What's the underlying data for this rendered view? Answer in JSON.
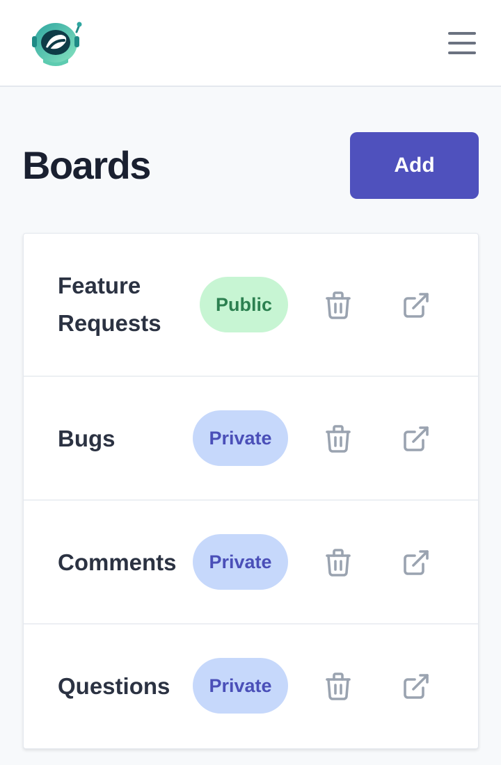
{
  "header": {
    "logo_icon": "astronaut-helmet-logo",
    "menu_icon": "hamburger-menu-icon"
  },
  "page": {
    "title": "Boards",
    "add_label": "Add"
  },
  "colors": {
    "primary": "#4f51bd",
    "public_bg": "#c7f5d3",
    "public_text": "#2c8050",
    "private_bg": "#c6d8fb",
    "private_text": "#4a4fb8",
    "icon_gray": "#9aa3b0"
  },
  "boards": [
    {
      "name": "Feature Requests",
      "visibility": "Public"
    },
    {
      "name": "Bugs",
      "visibility": "Private"
    },
    {
      "name": "Comments",
      "visibility": "Private"
    },
    {
      "name": "Questions",
      "visibility": "Private"
    }
  ]
}
